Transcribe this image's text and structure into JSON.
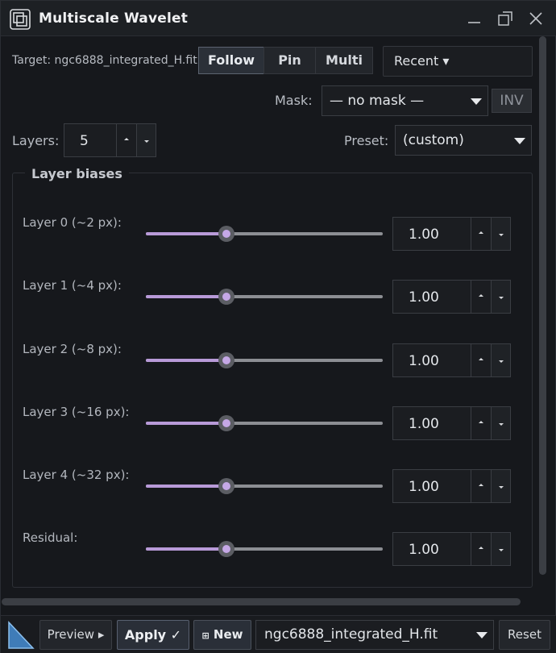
{
  "window": {
    "title": "Multiscale Wavelet"
  },
  "header": {
    "target_text": "Target: ngc6888_integrated_H.fit",
    "follow_label": "Follow",
    "pin_label": "Pin",
    "multi_label": "Multi",
    "recent_label": "Recent ▾"
  },
  "mask": {
    "label": "Mask:",
    "value": "— no mask —",
    "inv_label": "INV"
  },
  "layers": {
    "label": "Layers:",
    "value": "5"
  },
  "preset": {
    "label": "Preset:",
    "value": "(custom)"
  },
  "biases": {
    "title": "Layer biases",
    "rows": [
      {
        "label": "Layer 0 (~2 px):",
        "value": "1.00",
        "slider_fraction": 0.34
      },
      {
        "label": "Layer 1 (~4 px):",
        "value": "1.00",
        "slider_fraction": 0.34
      },
      {
        "label": "Layer 2 (~8 px):",
        "value": "1.00",
        "slider_fraction": 0.34
      },
      {
        "label": "Layer 3 (~16 px):",
        "value": "1.00",
        "slider_fraction": 0.34
      },
      {
        "label": "Layer 4 (~32 px):",
        "value": "1.00",
        "slider_fraction": 0.34
      },
      {
        "label": "Residual:",
        "value": "1.00",
        "slider_fraction": 0.34
      }
    ]
  },
  "footer": {
    "preview_label": "Preview ▸",
    "apply_label": "Apply ✓",
    "new_label": "New",
    "new_icon": "⊞",
    "target_file": "ngc6888_integrated_H.fit",
    "reset_label": "Reset"
  },
  "colors": {
    "accent": "#b89ad8",
    "knob": "#c5a8e6",
    "background": "#16181c"
  }
}
